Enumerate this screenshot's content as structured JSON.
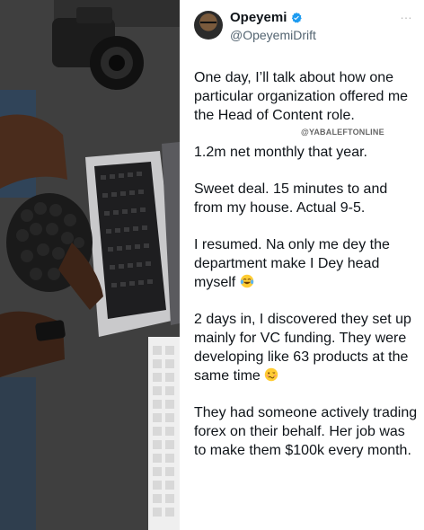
{
  "profile": {
    "display_name": "Opeyemi",
    "handle": "@OpeyemiDrift",
    "verified": true,
    "verified_color": "#1d9bf0"
  },
  "more_menu": "…",
  "watermark": "@YABALEFTONLINE",
  "tweet": {
    "paragraphs": [
      "One day, I’ll talk about how one particular organization offered me the Head of Content role.",
      "1.2m net monthly that year.",
      "Sweet deal. 15 minutes to and from my house. Actual 9-5.",
      "I resumed. Na only me dey the department make I Dey head myself",
      "2 days in, I discovered they set up mainly for VC funding. They were developing like 63 products at the same time",
      "They had someone actively trading forex on their behalf. Her job was to make them $100k every month."
    ],
    "emoji_laughing": "laughing-tears-emoji",
    "emoji_woozy": "woozy-face-emoji"
  }
}
